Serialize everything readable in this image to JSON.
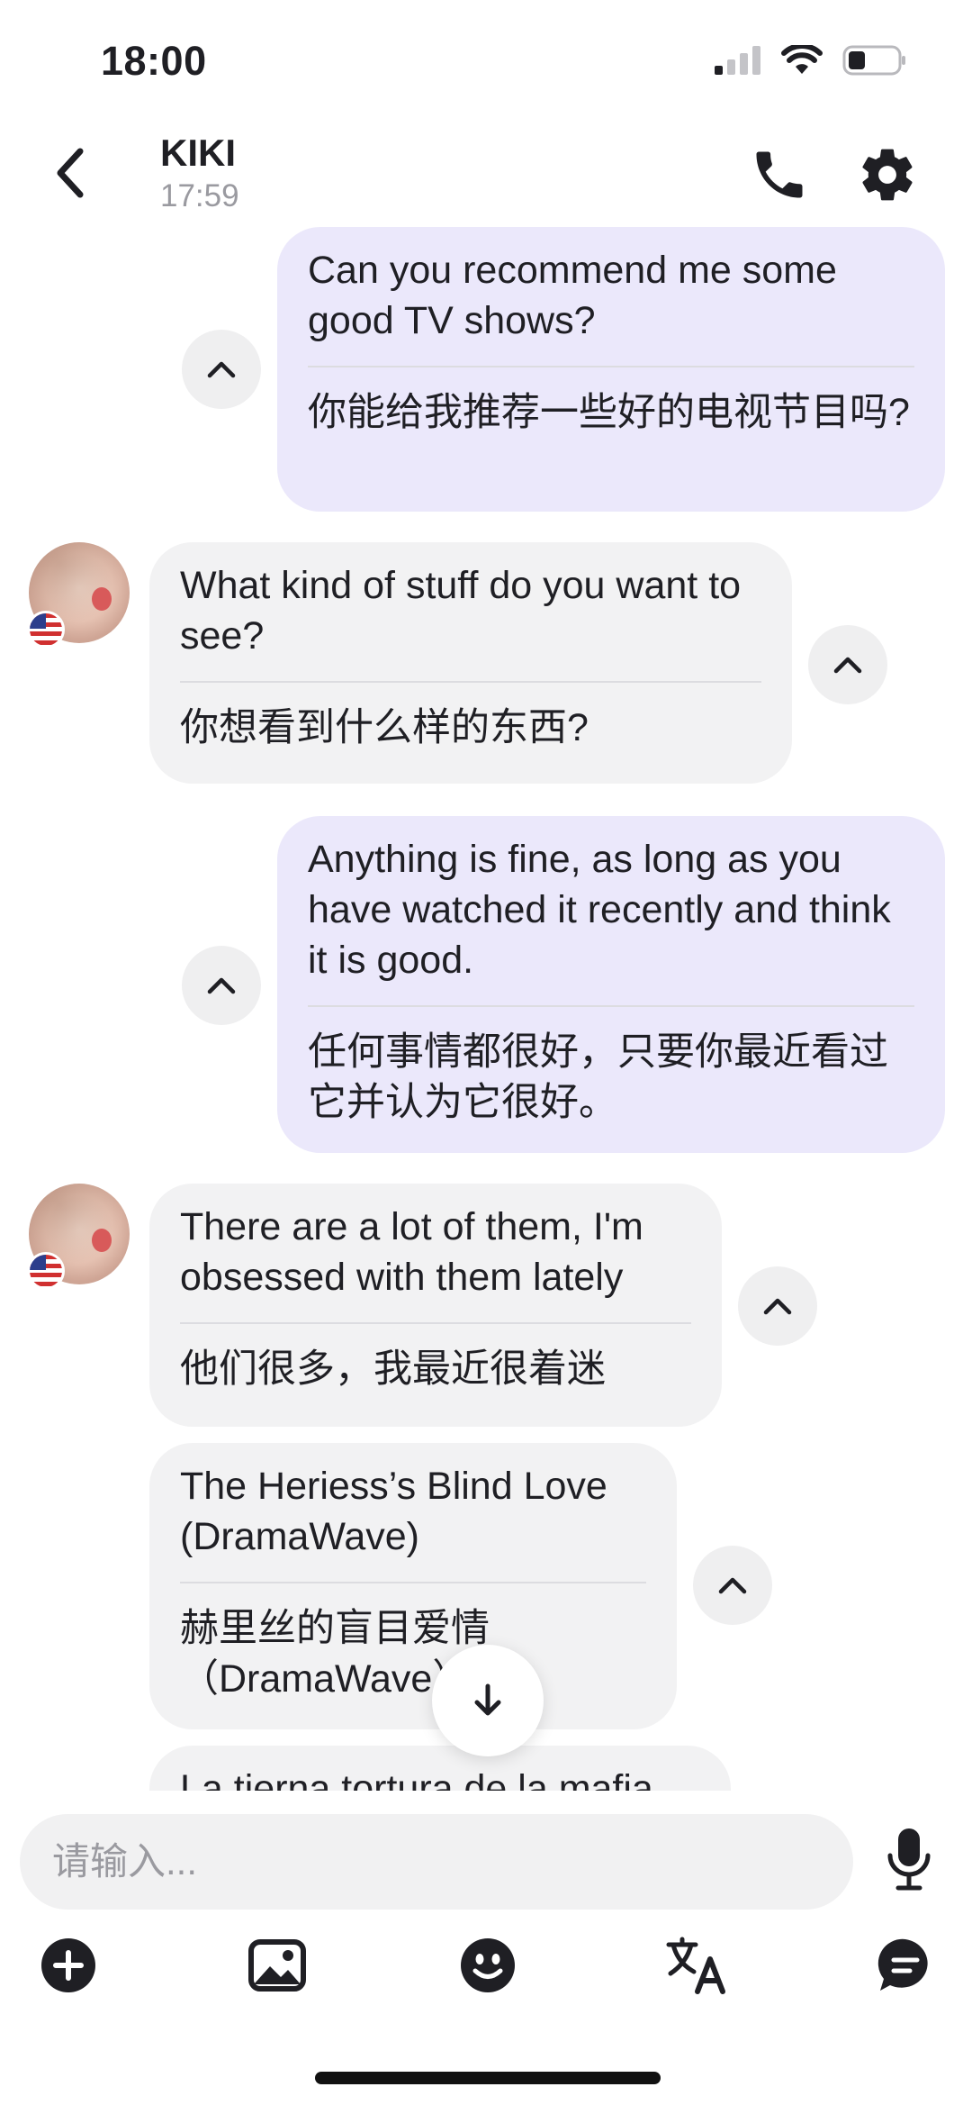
{
  "status_bar": {
    "time": "18:00",
    "signal_icon": "signal-icon",
    "wifi_icon": "wifi-icon",
    "battery_icon": "battery-icon"
  },
  "header": {
    "back_icon": "chevron-left-icon",
    "contact_name": "KIKI",
    "last_seen": "17:59",
    "call_icon": "phone-icon",
    "settings_icon": "gear-icon"
  },
  "messages": [
    {
      "direction": "outgoing",
      "text": "Can you recommend me some good TV shows?",
      "translation": "你能给我推荐一些好的电视节目吗?"
    },
    {
      "direction": "incoming",
      "text": "What kind of stuff do you want to see?",
      "translation": "你想看到什么样的东西?"
    },
    {
      "direction": "outgoing",
      "text": "Anything is fine, as long as you have watched it recently and think it is good.",
      "translation": "任何事情都很好，只要你最近看过它并认为它很好。"
    },
    {
      "direction": "incoming",
      "text": "There are a lot of them, I'm obsessed with them lately",
      "translation": "他们很多，我最近很着迷"
    },
    {
      "direction": "incoming",
      "text": "The Heriess’s Blind Love (DramaWave)",
      "translation": "赫里丝的盲目爱情（DramaWave）"
    },
    {
      "direction": "incoming",
      "text": "La tierna tortura de la mafia"
    }
  ],
  "composer": {
    "placeholder": "请输入...",
    "value": ""
  },
  "toolbar": [
    "plus-icon",
    "image-icon",
    "emoji-icon",
    "translate-icon",
    "chat-bubble-icon"
  ],
  "colors": {
    "outgoing_bubble": "#ebe8fb",
    "incoming_bubble": "#f2f2f3",
    "placeholder": "#9a9aa0"
  }
}
